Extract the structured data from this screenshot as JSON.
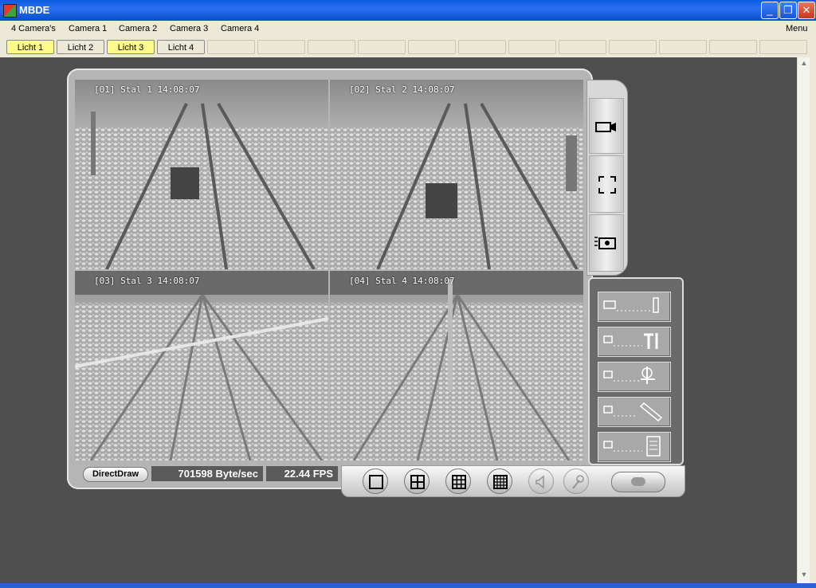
{
  "window": {
    "title": "MBDE",
    "icon": "app-icon",
    "minimize": "_",
    "restore": "❐",
    "close": "✕"
  },
  "menubar": {
    "items": [
      {
        "label": "4 Camera's"
      },
      {
        "label": "Camera 1"
      },
      {
        "label": "Camera 2"
      },
      {
        "label": "Camera 3"
      },
      {
        "label": "Camera 4"
      }
    ],
    "menu_label": "Menu"
  },
  "toolbar": {
    "light_buttons": [
      {
        "label": "Licht 1",
        "state": "on"
      },
      {
        "label": "Licht 2",
        "state": "off"
      },
      {
        "label": "Licht 3",
        "state": "on"
      },
      {
        "label": "Licht 4",
        "state": "off"
      }
    ],
    "active_color": "#fdfb8a"
  },
  "cameras": [
    {
      "osd": "[01] Stal 1 14:08:07"
    },
    {
      "osd": "[02] Stal 2 14:08:07"
    },
    {
      "osd": "[03] Stal 3 14:08:07"
    },
    {
      "osd": "[04] Stal 4 14:08:07"
    }
  ],
  "status": {
    "render_mode": "DirectDraw",
    "bitrate": "701598 Byte/sec",
    "fps": "22.44 FPS"
  },
  "side_buttons": [
    "camera-icon",
    "fullscreen-icon",
    "snapshot-icon"
  ],
  "tool_buttons": [
    "ptz-control-icon",
    "settings-tools-icon",
    "focus-adjust-icon",
    "pen-edit-icon",
    "log-document-icon"
  ],
  "layout_buttons": [
    "single-view-icon",
    "quad-view-icon",
    "nine-view-icon",
    "sixteen-view-icon"
  ],
  "audio_buttons": [
    "speaker-icon",
    "microphone-icon"
  ],
  "record_button": "record-toggle"
}
